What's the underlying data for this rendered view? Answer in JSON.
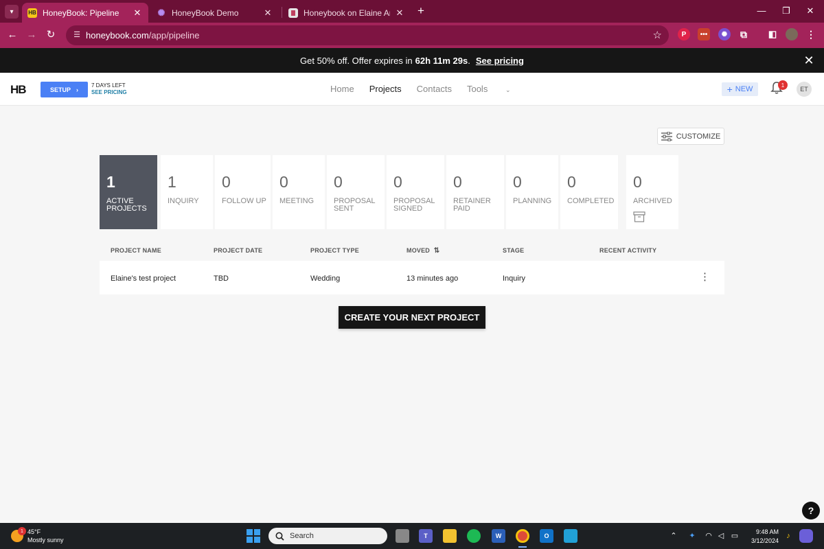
{
  "browser": {
    "tabs": [
      {
        "title": "HoneyBook: Pipeline",
        "favicon": "HB",
        "active": true
      },
      {
        "title": "HoneyBook Demo",
        "favicon": "gear",
        "active": false
      },
      {
        "title": "Honeybook on Elaine And Fran",
        "favicon": "doc",
        "active": false
      }
    ],
    "url_domain": "honeybook.com",
    "url_path": "/app/pipeline",
    "colors": {
      "frame": "#6b1036",
      "toolbar": "#a3235a"
    }
  },
  "promo": {
    "text": "Get 50% off. Offer expires in",
    "countdown": "62h 11m 29s",
    "suffix": ".",
    "link": "See pricing"
  },
  "header": {
    "logo": "HB",
    "setup_label": "SETUP",
    "trial_days": "7 DAYS LEFT",
    "trial_pricing": "SEE PRICING",
    "nav": [
      {
        "label": "Home",
        "active": false
      },
      {
        "label": "Projects",
        "active": true
      },
      {
        "label": "Contacts",
        "active": false
      },
      {
        "label": "Tools",
        "active": false
      }
    ],
    "new_label": "NEW",
    "notification_count": "1",
    "avatar_initials": "ET"
  },
  "customize_label": "CUSTOMIZE",
  "stages": [
    {
      "count": "1",
      "label": "ACTIVE PROJECTS",
      "active": true
    },
    {
      "count": "1",
      "label": "INQUIRY",
      "active": false
    },
    {
      "count": "0",
      "label": "FOLLOW UP",
      "active": false
    },
    {
      "count": "0",
      "label": "MEETING",
      "active": false
    },
    {
      "count": "0",
      "label": "PROPOSAL SENT",
      "active": false
    },
    {
      "count": "0",
      "label": "PROPOSAL SIGNED",
      "active": false
    },
    {
      "count": "0",
      "label": "RETAINER PAID",
      "active": false
    },
    {
      "count": "0",
      "label": "PLANNING",
      "active": false
    },
    {
      "count": "0",
      "label": "COMPLETED",
      "active": false
    },
    {
      "count": "0",
      "label": "ARCHIVED",
      "active": false
    }
  ],
  "table": {
    "columns": [
      "PROJECT NAME",
      "PROJECT DATE",
      "PROJECT TYPE",
      "MOVED",
      "STAGE",
      "RECENT ACTIVITY"
    ],
    "rows": [
      {
        "name": "Elaine's test project",
        "date": "TBD",
        "type": "Wedding",
        "moved": "13 minutes ago",
        "stage": "Inquiry",
        "activity": ""
      }
    ]
  },
  "create_button": "CREATE YOUR NEXT PROJECT",
  "help_label": "?",
  "taskbar": {
    "weather_temp": "45°F",
    "weather_desc": "Mostly sunny",
    "weather_badge": "1",
    "search_label": "Search",
    "time": "9:48 AM",
    "date": "3/12/2024"
  }
}
